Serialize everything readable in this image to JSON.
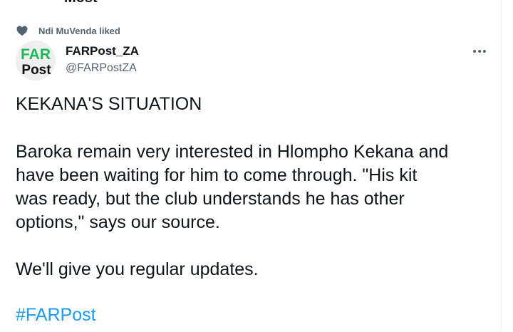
{
  "cut_header": {
    "text": "Most"
  },
  "social_context": {
    "text": "Ndi MuVenda liked",
    "icon": "heart-icon"
  },
  "author": {
    "display_name": "FARPost_ZA",
    "handle": "@FARPostZA",
    "avatar_text_top": "FAR",
    "avatar_text_bottom": "Post"
  },
  "menu": {
    "icon": "more-icon"
  },
  "tweet": {
    "headline": "KEKANA'S SITUATION",
    "paragraph1": [
      "Baroka remain very interested in Hlompho Kekana and",
      "have been waiting for him to come through. \"His kit",
      "was ready, but the club understands he has other",
      "options,\" says our source."
    ],
    "paragraph2": "We'll give you regular updates.",
    "hashtag": "#FARPost"
  },
  "colors": {
    "text": "#0f1419",
    "secondary": "#536471",
    "link": "#1d9bf0",
    "logo_green": "#1db954"
  }
}
